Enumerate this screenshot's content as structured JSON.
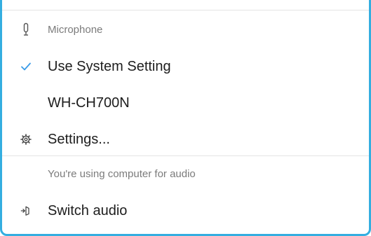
{
  "colors": {
    "accent": "#34aee0",
    "check": "#3a9be8",
    "divider": "#e4e4e4",
    "text": "#1d1d1d",
    "muted": "#7b7b7b"
  },
  "microphone_section": {
    "icon": "microphone-icon",
    "label": "Microphone"
  },
  "microphone_options": [
    {
      "label": "Use System Setting",
      "selected": true,
      "icon": "checkmark-icon"
    },
    {
      "label": "WH-CH700N",
      "selected": false
    }
  ],
  "settings": {
    "icon": "gear-icon",
    "label": "Settings..."
  },
  "audio_status": {
    "label": "You're using computer for audio"
  },
  "switch_audio": {
    "icon": "switch-audio-icon",
    "label": "Switch audio"
  }
}
